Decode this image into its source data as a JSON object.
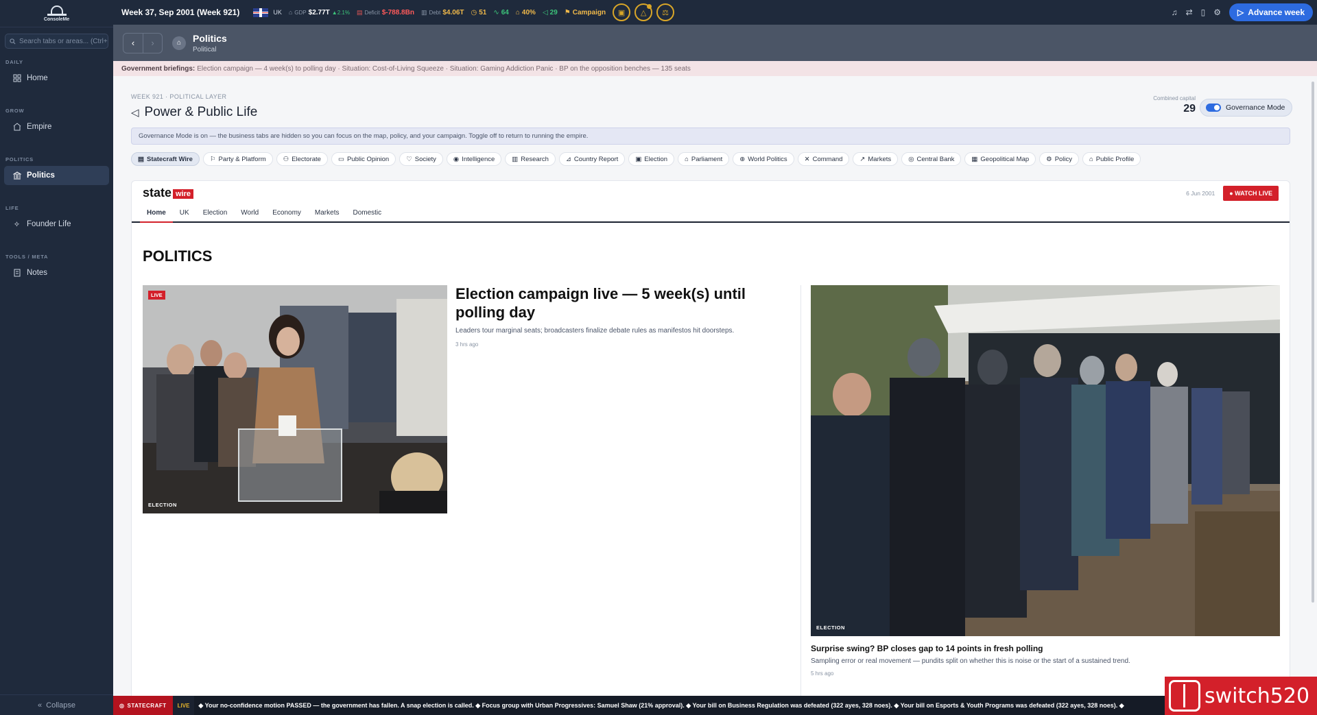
{
  "sidebar": {
    "logo_text": "ConsoleMe",
    "search_placeholder": "Search tabs or areas... (Ctrl+",
    "sections": [
      {
        "label": "DAILY",
        "item": "Home"
      },
      {
        "label": "GROW",
        "item": "Empire"
      },
      {
        "label": "POLITICS",
        "item": "Politics"
      },
      {
        "label": "LIFE",
        "item": "Founder Life"
      },
      {
        "label": "TOOLS / META",
        "item": "Notes"
      }
    ],
    "collapse_label": "Collapse"
  },
  "topbar": {
    "week": "Week 37, Sep 2001 (Week 921)",
    "country": "UK",
    "gdp_label": "GDP",
    "gdp": "$2.77T",
    "gdp_change": "▲2.1%",
    "deficit_label": "Deficit",
    "deficit": "$-788.8Bn",
    "debt_label": "Debt",
    "debt": "$4.06T",
    "stat1": "51",
    "stat2": "64",
    "stat3": "40%",
    "stat4": "29",
    "campaign": "Campaign",
    "advance_label": "Advance week"
  },
  "header": {
    "title": "Politics",
    "subtitle": "Political"
  },
  "briefing": {
    "label": "Government briefings:",
    "text": "Election campaign — 4 week(s) to polling day · Situation: Cost-of-Living Squeeze · Situation: Gaming Addiction Panic · BP on the opposition benches — 135 seats"
  },
  "page": {
    "kicker": "WEEK 921 · POLITICAL LAYER",
    "title": "Power & Public Life",
    "capital_label": "Combined capital",
    "capital_value": "29",
    "governance_label": "Governance Mode",
    "notice": "Governance Mode is on — the business tabs are hidden so you can focus on the map, policy, and your campaign. Toggle off to return to running the empire."
  },
  "tabs": [
    "Statecraft Wire",
    "Party & Platform",
    "Electorate",
    "Public Opinion",
    "Society",
    "Intelligence",
    "Research",
    "Country Report",
    "Election",
    "Parliament",
    "World Politics",
    "Command",
    "Markets",
    "Central Bank",
    "Geopolitical Map",
    "Policy",
    "Public Profile"
  ],
  "wire": {
    "brand": "state",
    "brand_tag": "wire",
    "date": "6 Jun 2001",
    "watch_live": "● WATCH LIVE",
    "nav": [
      "Home",
      "UK",
      "Election",
      "World",
      "Economy",
      "Markets",
      "Domestic"
    ],
    "section_title": "POLITICS",
    "lead": {
      "live_tag": "LIVE",
      "category": "ELECTION",
      "headline": "Election campaign live — 5 week(s) until polling day",
      "summary": "Leaders tour marginal seats; broadcasters finalize debate rules as manifestos hit doorsteps.",
      "age": "3 hrs ago"
    },
    "second": {
      "category": "ELECTION",
      "headline": "Surprise swing? BP closes gap to 14 points in fresh polling",
      "summary": "Sampling error or real movement — pundits split on whether this is noise or the start of a sustained trend.",
      "age": "5 hrs ago"
    }
  },
  "ticker": {
    "brand": "STATECRAFT",
    "live": "LIVE",
    "text": "◆ Your no-confidence motion PASSED — the government has fallen. A snap election is called. ◆ Focus group with Urban Progressives: Samuel Shaw (21% approval). ◆ Your bill on Business Regulation was defeated (322 ayes, 328 noes). ◆ Your bill on Esports & Youth Programs was defeated (322 ayes, 328 noes). ◆"
  },
  "watermark": "switch520"
}
